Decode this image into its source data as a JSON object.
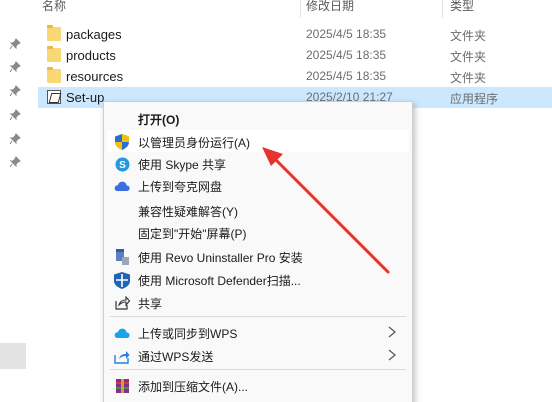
{
  "header": {
    "name": "名称",
    "date": "修改日期",
    "type": "类型"
  },
  "files": [
    {
      "name": "packages",
      "date": "2025/4/5 18:35",
      "type": "文件夹",
      "icon": "folder-icon"
    },
    {
      "name": "products",
      "date": "2025/4/5 18:35",
      "type": "文件夹",
      "icon": "folder-icon"
    },
    {
      "name": "resources",
      "date": "2025/4/5 18:35",
      "type": "文件夹",
      "icon": "folder-icon"
    },
    {
      "name": "Set-up",
      "date": "2025/2/10 21:27",
      "type": "应用程序",
      "icon": "application-icon"
    }
  ],
  "context_menu": {
    "items": [
      {
        "label": "打开(O)",
        "icon": "none"
      },
      {
        "label": "以管理员身份运行(A)",
        "icon": "uac-shield-icon"
      },
      {
        "label": "使用 Skype 共享",
        "icon": "skype-icon"
      },
      {
        "label": "上传到夸克网盘",
        "icon": "quark-cloud-icon"
      },
      {
        "label": "兼容性疑难解答(Y)",
        "icon": "none"
      },
      {
        "label": "固定到\"开始\"屏幕(P)",
        "icon": "none"
      },
      {
        "label": "使用 Revo Uninstaller Pro 安装",
        "icon": "revo-uninstaller-icon"
      },
      {
        "label": "使用 Microsoft Defender扫描...",
        "icon": "defender-shield-icon"
      },
      {
        "label": "共享",
        "icon": "share-icon"
      },
      {
        "label": "上传或同步到WPS",
        "icon": "wps-cloud-icon"
      },
      {
        "label": "通过WPS发送",
        "icon": "wps-send-icon"
      },
      {
        "label": "添加到压缩文件(A)...",
        "icon": "winrar-icon"
      }
    ]
  },
  "colors": {
    "selection": "#cce8ff",
    "annotation_arrow": "#e8322d",
    "folder": "#f8d775"
  }
}
